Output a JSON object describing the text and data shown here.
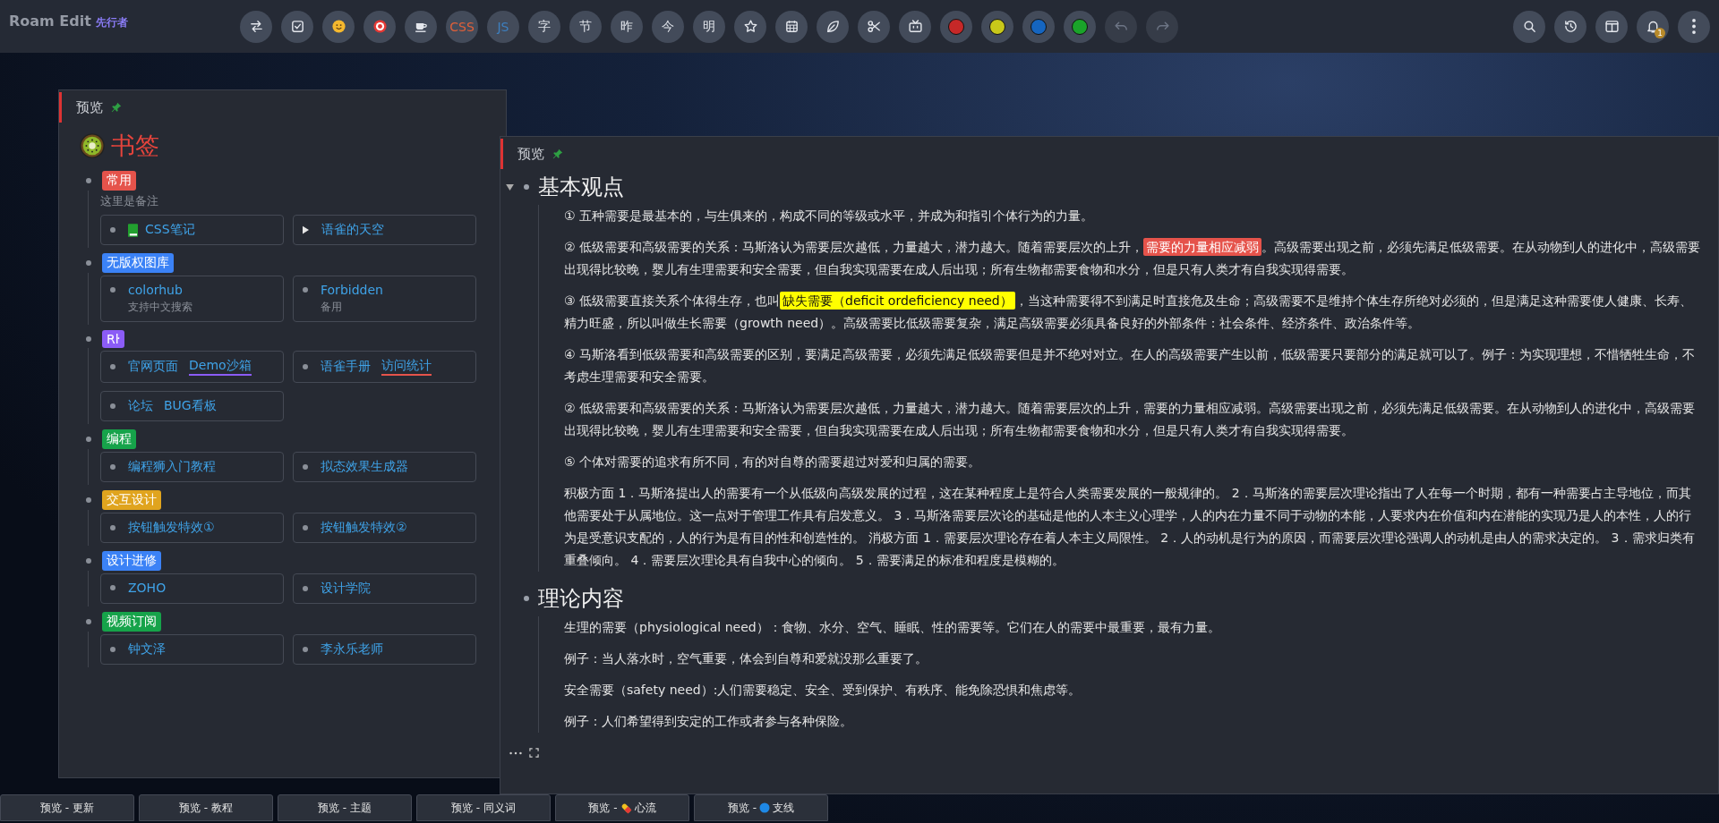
{
  "brand": {
    "name": "Roam Edit",
    "tag": "先行者"
  },
  "toolbar": [
    {
      "kind": "icon",
      "disabled": false
    },
    {
      "kind": "icon",
      "disabled": false
    },
    {
      "kind": "icon",
      "disabled": false
    },
    {
      "kind": "icon",
      "disabled": false
    },
    {
      "kind": "icon",
      "disabled": false
    },
    {
      "kind": "text-warm",
      "label": "CSS"
    },
    {
      "kind": "text-cool",
      "label": "JS"
    },
    {
      "kind": "text",
      "label": "字"
    },
    {
      "kind": "text",
      "label": "节"
    },
    {
      "kind": "text",
      "label": "昨"
    },
    {
      "kind": "text",
      "label": "今"
    },
    {
      "kind": "text",
      "label": "明"
    },
    {
      "kind": "icon",
      "disabled": false
    },
    {
      "kind": "icon",
      "disabled": false
    },
    {
      "kind": "icon",
      "disabled": false
    },
    {
      "kind": "icon",
      "disabled": false
    },
    {
      "kind": "icon",
      "disabled": false
    },
    {
      "kind": "swatch",
      "color": "#c62828"
    },
    {
      "kind": "swatch",
      "color": "#c8c81a"
    },
    {
      "kind": "swatch",
      "color": "#1565c0"
    },
    {
      "kind": "swatch",
      "color": "#1aa32a"
    },
    {
      "kind": "icon",
      "disabled": true
    },
    {
      "kind": "icon",
      "disabled": true
    }
  ],
  "tools": [
    {
      "kind": "icon"
    },
    {
      "kind": "icon"
    },
    {
      "kind": "icon"
    },
    {
      "kind": "bell",
      "badge": "1"
    },
    {
      "kind": "icon"
    }
  ],
  "bookmarks_panel": {
    "title": "预览",
    "pinned": true,
    "heading": "书签",
    "groups": [
      {
        "tag": "常用",
        "color": "#e5534b",
        "note": "这里是备注",
        "cards": [
          {
            "kind": "page",
            "collapsed": false,
            "links": [
              {
                "text": "CSS笔记"
              }
            ]
          },
          {
            "kind": "link",
            "collapsed": true,
            "links": [
              {
                "text": "语雀的天空"
              }
            ]
          }
        ]
      },
      {
        "tag": "无版权图库",
        "color": "#3b82f6",
        "cards": [
          {
            "kind": "link",
            "collapsed": false,
            "links": [
              {
                "text": "colorhub"
              }
            ],
            "note": "支持中文搜索"
          },
          {
            "kind": "link",
            "collapsed": false,
            "links": [
              {
                "text": "Forbidden"
              }
            ],
            "note": "备用"
          }
        ]
      },
      {
        "tag": "Rŀ",
        "color": "#8b5cf6",
        "cards": [
          {
            "kind": "link",
            "collapsed": false,
            "links": [
              {
                "text": "官网页面"
              },
              {
                "text": "Demo沙箱",
                "color": "#8b5cf6"
              }
            ]
          },
          {
            "kind": "link",
            "collapsed": false,
            "links": [
              {
                "text": "语雀手册"
              },
              {
                "text": "访问统计",
                "color": "#e5534b"
              }
            ]
          },
          {
            "kind": "link",
            "collapsed": false,
            "links": [
              {
                "text": "论坛"
              },
              {
                "text": "BUG看板"
              }
            ]
          }
        ]
      },
      {
        "tag": "编程",
        "color": "#16a34a",
        "cards": [
          {
            "kind": "link",
            "collapsed": false,
            "links": [
              {
                "text": "编程狮入门教程"
              }
            ]
          },
          {
            "kind": "link",
            "collapsed": false,
            "links": [
              {
                "text": "拟态效果生成器"
              }
            ]
          }
        ]
      },
      {
        "tag": "交互设计",
        "color": "#e0a41e",
        "cards": [
          {
            "kind": "link",
            "collapsed": false,
            "links": [
              {
                "text": "按钮触发特效①"
              }
            ]
          },
          {
            "kind": "link",
            "collapsed": false,
            "links": [
              {
                "text": "按钮触发特效②"
              }
            ]
          }
        ]
      },
      {
        "tag": "设计进修",
        "color": "#3b82f6",
        "cards": [
          {
            "kind": "link",
            "collapsed": false,
            "links": [
              {
                "text": "ZOHO"
              }
            ]
          },
          {
            "kind": "link",
            "collapsed": false,
            "links": [
              {
                "text": "设计学院"
              }
            ]
          }
        ]
      },
      {
        "tag": "视频订阅",
        "color": "#16a34a",
        "cards": [
          {
            "kind": "link",
            "collapsed": false,
            "links": [
              {
                "text": "钟文泽"
              }
            ]
          },
          {
            "kind": "link",
            "collapsed": false,
            "links": [
              {
                "text": "李永乐老师"
              }
            ]
          }
        ]
      }
    ]
  },
  "notes_panel": {
    "title": "预览",
    "pinned": true,
    "sections": [
      {
        "heading": "基本观点",
        "hovered": true,
        "paragraphs": [
          [
            {
              "text": "① 五种需要是最基本的，与生俱来的，构成不同的等级或水平，并成为和指引个体行为的力量。"
            }
          ],
          [
            {
              "text": "② 低级需要和高级需要的关系：马斯洛认为需要层次越低，力量越大，潜力越大。随着需要层次的上升，"
            },
            {
              "text": "需要的力量相应减弱",
              "color": "#e5534b"
            },
            {
              "text": "。高级需要出现之前，必须先满足低级需要。在从动物到人的进化中，高级需要出现得比较晚，婴儿有生理需要和安全需要，但自我实现需要在成人后出现；所有生物都需要食物和水分，但是只有人类才有自我实现得需要。"
            }
          ],
          [
            {
              "text": "③ 低级需要直接关系个体得生存，也叫"
            },
            {
              "text": "缺失需要（deficit ordeficiency need）",
              "color": "#ffff00"
            },
            {
              "text": "，当这种需要得不到满足时直接危及生命；高级需要不是维持个体生存所绝对必须的，但是满足这种需要使人健康、长寿、精力旺盛，所以叫做生长需要（growth need）。高级需要比低级需要复杂，满足高级需要必须具备良好的外部条件：社会条件、经济条件、政治条件等。"
            }
          ],
          [
            {
              "text": "④ 马斯洛看到低级需要和高级需要的区别，要满足高级需要，必须先满足低级需要但是并不绝对对立。在人的高级需要产生以前，低级需要只要部分的满足就可以了。例子：为实现理想，不惜牺牲生命，不考虑生理需要和安全需要。"
            }
          ],
          [
            {
              "text": "② 低级需要和高级需要的关系：马斯洛认为需要层次越低，力量越大，潜力越大。随着需要层次的上升，需要的力量相应减弱。高级需要出现之前，必须先满足低级需要。在从动物到人的进化中，高级需要出现得比较晚，婴儿有生理需要和安全需要，但自我实现需要在成人后出现；所有生物都需要食物和水分，但是只有人类才有自我实现得需要。"
            }
          ],
          [
            {
              "text": "⑤ 个体对需要的追求有所不同，有的对自尊的需要超过对爱和归属的需要。"
            }
          ],
          [
            {
              "text": "积极方面 1．马斯洛提出人的需要有一个从低级向高级发展的过程，这在某种程度上是符合人类需要发展的一般规律的。 2．马斯洛的需要层次理论指出了人在每一个时期，都有一种需要占主导地位，而其他需要处于从属地位。这一点对于管理工作具有启发意义。 3．马斯洛需要层次论的基础是他的人本主义心理学，人的内在力量不同于动物的本能，人要求内在价值和内在潜能的实现乃是人的本性，人的行为是受意识支配的，人的行为是有目的性和创造性的。 消极方面 1．需要层次理论存在着人本主义局限性。 2．人的动机是行为的原因，而需要层次理论强调人的动机是由人的需求决定的。 3．需求归类有重叠倾向。 4．需要层次理论具有自我中心的倾向。 5．需要满足的标准和程度是模糊的。"
            }
          ]
        ]
      },
      {
        "heading": "理论内容",
        "hovered": false,
        "paragraphs": [
          [
            {
              "text": "生理的需要（physiological need）：食物、水分、空气、睡眠、性的需要等。它们在人的需要中最重要，最有力量。"
            }
          ],
          [
            {
              "text": "例子：当人落水时，空气重要，体会到自尊和爱就没那么重要了。"
            }
          ],
          [
            {
              "text": "安全需要（safety need）:人们需要稳定、安全、受到保护、有秩序、能免除恐惧和焦虑等。"
            }
          ],
          [
            {
              "text": "例子：人们希望得到安定的工作或者参与各种保险。"
            }
          ]
        ]
      }
    ]
  },
  "taskbar": [
    {
      "title": "预览 -",
      "label": "更新",
      "kind": "plain"
    },
    {
      "title": "预览 -",
      "label": "教程",
      "kind": "plain"
    },
    {
      "title": "预览 -",
      "label": "主题",
      "kind": "plain"
    },
    {
      "title": "预览 -",
      "label": "同义词",
      "kind": "plain"
    },
    {
      "title": "预览 -",
      "label": "心流",
      "kind": "pill"
    },
    {
      "title": "预览 -",
      "label": "支线",
      "kind": "dot"
    }
  ]
}
